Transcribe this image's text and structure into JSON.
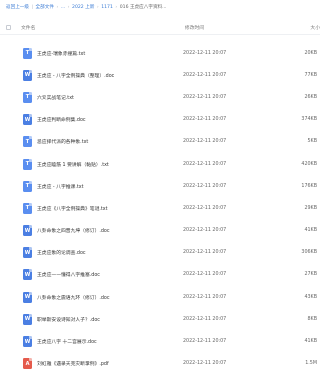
{
  "breadcrumb": {
    "back": "返回上一级",
    "all": "全部文件",
    "ellipsis": "...",
    "p1": "2022 上新",
    "p2": "1171",
    "current": "016 王虎应八字资料..."
  },
  "columns": {
    "name": "文件名",
    "date": "修改时间",
    "size": "大小"
  },
  "files": [
    {
      "name": "王虎应-瑞象赤撞篇.txt",
      "date": "2022-12-11 20:07",
      "size": "20KB",
      "type": "txt",
      "glyph": "T"
    },
    {
      "name": "王虎应 - 八字全例操典（整理）.doc",
      "date": "2022-12-11 20:07",
      "size": "77KB",
      "type": "doc",
      "glyph": "W"
    },
    {
      "name": "六爻实战笔记.txt",
      "date": "2022-12-11 20:07",
      "size": "26KB",
      "type": "txt",
      "glyph": "T"
    },
    {
      "name": "王虎应判断命例集.doc",
      "date": "2022-12-11 20:07",
      "size": "374KB",
      "type": "doc",
      "glyph": "W"
    },
    {
      "name": "忌应择代派的各种象.txt",
      "date": "2022-12-11 20:07",
      "size": "5KB",
      "type": "txt",
      "glyph": "T"
    },
    {
      "name": "王虎应瞌筋 1 要讲解（黏贴）.txt",
      "date": "2022-12-11 20:07",
      "size": "420KB",
      "type": "txt",
      "glyph": "T"
    },
    {
      "name": "王虎应 - 八字推课.txt",
      "date": "2022-12-11 20:07",
      "size": "176KB",
      "type": "txt",
      "glyph": "T"
    },
    {
      "name": "王虎应《八字全例操典》笔谜.txt",
      "date": "2022-12-11 20:07",
      "size": "29KB",
      "type": "txt",
      "glyph": "T"
    },
    {
      "name": "八卦命象之四晋九坤（修订）.doc",
      "date": "2022-12-11 20:07",
      "size": "41KB",
      "type": "doc",
      "glyph": "W"
    },
    {
      "name": "王虎应象的论调查.doc",
      "date": "2022-12-11 20:07",
      "size": "306KB",
      "type": "doc",
      "glyph": "W"
    },
    {
      "name": "王虎应——懂得八字推塞.doc",
      "date": "2022-12-11 20:07",
      "size": "27KB",
      "type": "doc",
      "glyph": "W"
    },
    {
      "name": "八卦命象之震语九环（修订）.doc",
      "date": "2022-12-11 20:07",
      "size": "43KB",
      "type": "doc",
      "glyph": "W"
    },
    {
      "name": "职举斯安设诗知对人子？.doc",
      "date": "2022-12-11 20:07",
      "size": "8KB",
      "type": "doc",
      "glyph": "W"
    },
    {
      "name": "王虎应八字 十二宫展示.doc",
      "date": "2022-12-11 20:07",
      "size": "41KB",
      "type": "doc",
      "glyph": "W"
    },
    {
      "name": "刘虹雅《遇录天克灾断掌例》.pdf",
      "date": "2022-12-11 20:07",
      "size": "1.5M",
      "type": "pdf",
      "glyph": "A"
    }
  ]
}
